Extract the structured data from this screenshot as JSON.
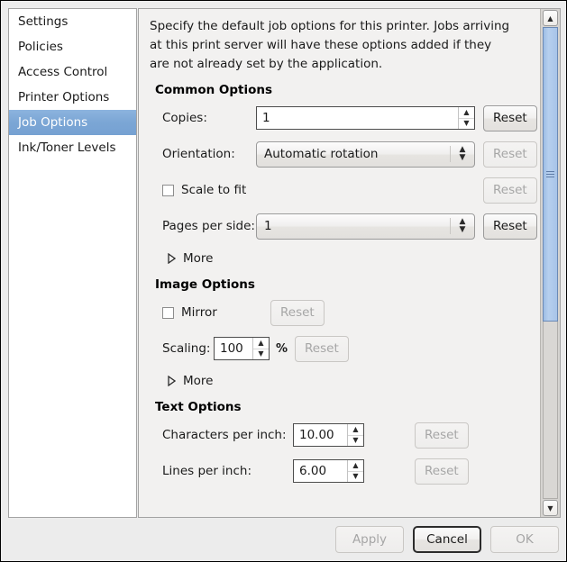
{
  "sidebar": {
    "items": [
      {
        "label": "Settings",
        "selected": false
      },
      {
        "label": "Policies",
        "selected": false
      },
      {
        "label": "Access Control",
        "selected": false
      },
      {
        "label": "Printer Options",
        "selected": false
      },
      {
        "label": "Job Options",
        "selected": true
      },
      {
        "label": "Ink/Toner Levels",
        "selected": false
      }
    ]
  },
  "main": {
    "intro": "Specify the default job options for this printer. Jobs arriving at this print server will have these options added if they are not already set by the application.",
    "sections": {
      "common": {
        "heading": "Common Options",
        "copies": {
          "label": "Copies:",
          "value": "1",
          "reset_label": "Reset",
          "reset_disabled": false
        },
        "orientation": {
          "label": "Orientation:",
          "value": "Automatic rotation",
          "reset_label": "Reset",
          "reset_disabled": true
        },
        "scale_to_fit": {
          "label": "Scale to fit",
          "checked": false,
          "reset_label": "Reset",
          "reset_disabled": true
        },
        "pages_per_side": {
          "label": "Pages per side:",
          "value": "1",
          "reset_label": "Reset",
          "reset_disabled": false
        },
        "more_label": "More"
      },
      "image": {
        "heading": "Image Options",
        "mirror": {
          "label": "Mirror",
          "checked": false,
          "reset_label": "Reset",
          "reset_disabled": true
        },
        "scaling": {
          "label": "Scaling:",
          "value": "100",
          "unit": "%",
          "reset_label": "Reset",
          "reset_disabled": true
        },
        "more_label": "More"
      },
      "text": {
        "heading": "Text Options",
        "cpi": {
          "label": "Characters per inch:",
          "value": "10.00",
          "reset_label": "Reset",
          "reset_disabled": true
        },
        "lpi": {
          "label": "Lines per inch:",
          "value": "6.00",
          "reset_label": "Reset",
          "reset_disabled": true
        }
      }
    }
  },
  "scrollbar": {
    "up_icon": "chevron-up-icon",
    "down_icon": "chevron-down-icon",
    "up_glyph": "▲",
    "down_glyph": "▼"
  },
  "footer": {
    "apply": {
      "label": "Apply",
      "disabled": true
    },
    "cancel": {
      "label": "Cancel",
      "disabled": false,
      "default": true
    },
    "ok": {
      "label": "OK",
      "disabled": true
    }
  },
  "colors": {
    "selection": "#7ba6d5",
    "scroll_thumb": "#a8c4e8",
    "window_bg": "#ececec",
    "panel_bg": "#f2f1f0"
  }
}
